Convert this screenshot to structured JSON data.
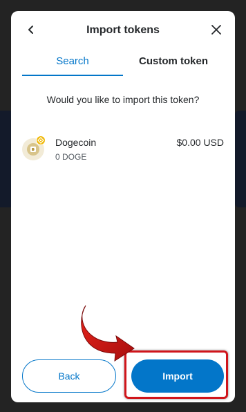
{
  "dialog": {
    "title": "Import tokens",
    "tabs": [
      {
        "label": "Search",
        "active": true
      },
      {
        "label": "Custom token",
        "active": false
      }
    ],
    "question": "Would you like to import this token?"
  },
  "token": {
    "name": "Dogecoin",
    "amount": "0 DOGE",
    "value": "$0.00 USD",
    "icon": "dogecoin-icon",
    "badge_icon": "bnb-chain-badge-icon"
  },
  "buttons": {
    "back_label": "Back",
    "import_label": "Import"
  },
  "colors": {
    "accent": "#0376c9",
    "highlight": "#d0151b",
    "backdrop": "#232323"
  }
}
